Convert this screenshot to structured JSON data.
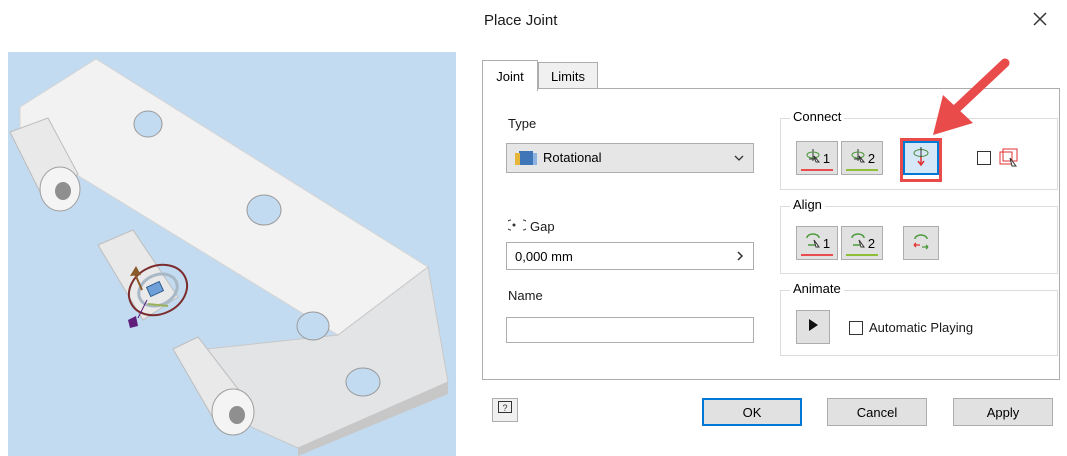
{
  "dialog": {
    "title": "Place Joint",
    "tabs": [
      {
        "label": "Joint"
      },
      {
        "label": "Limits"
      }
    ],
    "type": {
      "label": "Type",
      "value": "Rotational"
    },
    "gap": {
      "label": "Gap",
      "value": "0,000 mm"
    },
    "name": {
      "label": "Name",
      "value": ""
    },
    "connect": {
      "label": "Connect",
      "btn1": "1",
      "btn2": "2"
    },
    "align": {
      "label": "Align",
      "btn1": "1",
      "btn2": "2"
    },
    "animate": {
      "label": "Animate",
      "automatic_playing": "Automatic Playing"
    },
    "buttons": {
      "ok": "OK",
      "cancel": "Cancel",
      "apply": "Apply"
    }
  },
  "colors": {
    "accent": "#0078d7",
    "annotation": "#e94a4a",
    "viewport_bg": "#c3dbf0"
  }
}
